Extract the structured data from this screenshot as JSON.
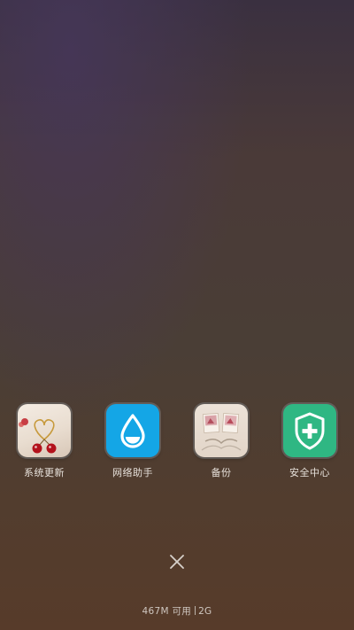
{
  "apps": [
    {
      "label": "系统更新",
      "icon": "theme-wallpaper-icon"
    },
    {
      "label": "网络助手",
      "icon": "water-drop-icon"
    },
    {
      "label": "备份",
      "icon": "backup-photos-icon"
    },
    {
      "label": "安全中心",
      "icon": "shield-plus-icon"
    }
  ],
  "close_icon": "close-icon",
  "memory": {
    "available": "467M 可用",
    "network": "2G"
  },
  "colors": {
    "network_icon_bg": "#14a6e6",
    "security_icon_bg": "#2fb783"
  }
}
